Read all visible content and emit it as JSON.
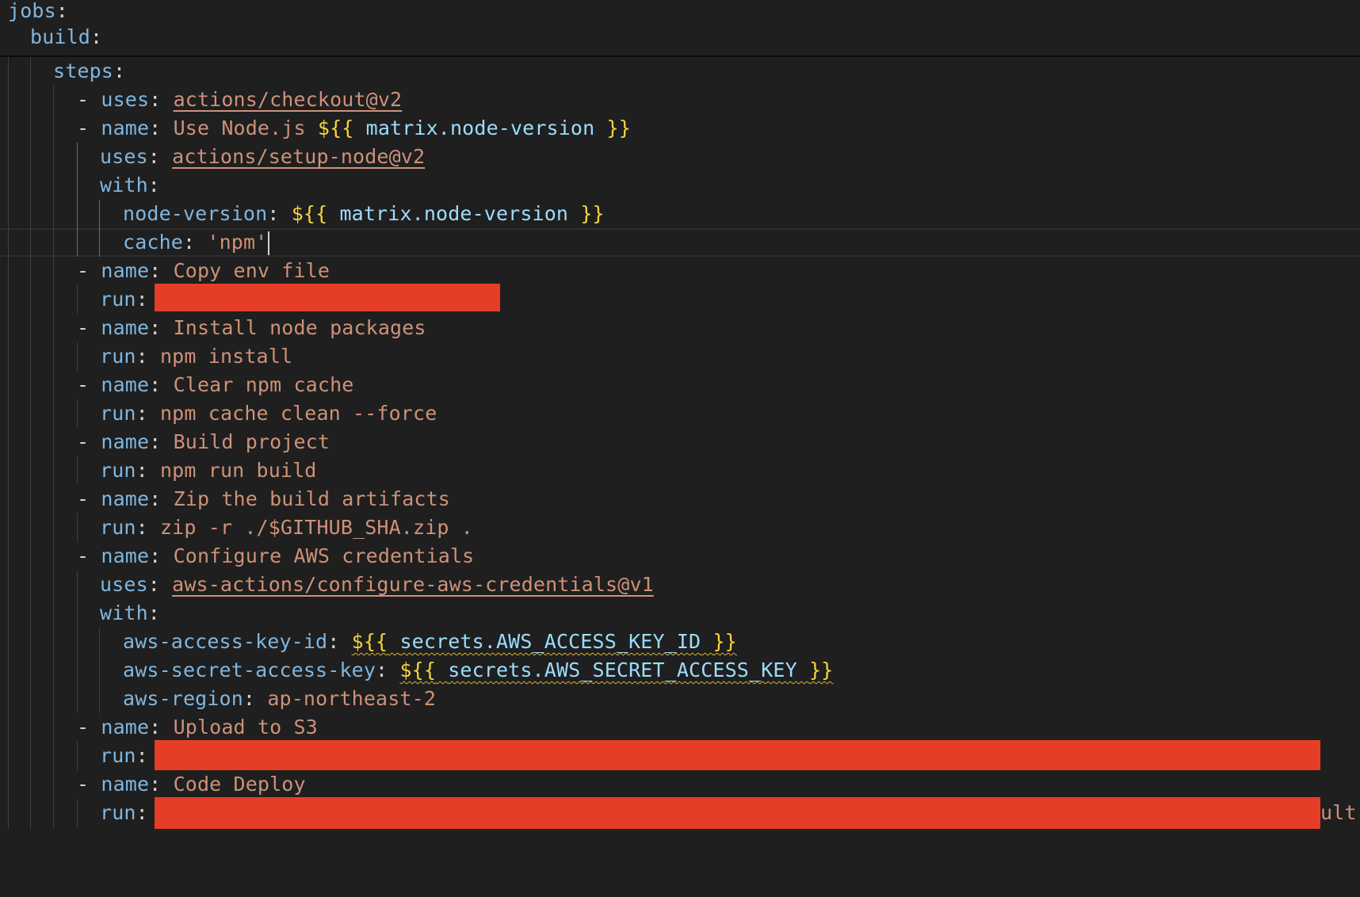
{
  "editor": {
    "language": "yaml",
    "sticky": {
      "jobs": "jobs",
      "build": "build"
    },
    "punct": {
      "colon": ":",
      "dash": "-"
    },
    "steps_key": "steps",
    "step_checkout": {
      "uses_key": "uses",
      "uses_value": "actions/checkout@v2"
    },
    "step_node": {
      "name_key": "name",
      "name_text": "Use Node.js ",
      "expr_open": "${{",
      "expr_var": "matrix.node-version",
      "expr_close": "}}",
      "uses_key": "uses",
      "uses_value": "actions/setup-node@v2",
      "with_key": "with",
      "node_version_key": "node-version",
      "cache_key": "cache",
      "cache_value": "'npm'"
    },
    "step_env": {
      "name_key": "name",
      "name_value": "Copy env file",
      "run_key": "run",
      "run_redacted": true
    },
    "step_install": {
      "name_key": "name",
      "name_value": "Install node packages",
      "run_key": "run",
      "run_value": "npm install"
    },
    "step_clear": {
      "name_key": "name",
      "name_value": "Clear npm cache",
      "run_key": "run",
      "run_value": "npm cache clean --force"
    },
    "step_build": {
      "name_key": "name",
      "name_value": "Build project",
      "run_key": "run",
      "run_value": "npm run build"
    },
    "step_zip": {
      "name_key": "name",
      "name_value": "Zip the build artifacts",
      "run_key": "run",
      "run_value": "zip -r ./$GITHUB_SHA.zip ."
    },
    "step_aws": {
      "name_key": "name",
      "name_value": "Configure AWS credentials",
      "uses_key": "uses",
      "uses_value": "aws-actions/configure-aws-credentials@v1",
      "with_key": "with",
      "access_key_key": "aws-access-key-id",
      "access_key_var": "secrets.AWS_ACCESS_KEY_ID",
      "secret_key_key": "aws-secret-access-key",
      "secret_key_var": "secrets.AWS_SECRET_ACCESS_KEY",
      "region_key": "aws-region",
      "region_value": "ap-northeast-2"
    },
    "step_s3": {
      "name_key": "name",
      "name_value": "Upload to S3",
      "run_key": "run",
      "run_redacted": true
    },
    "step_deploy": {
      "name_key": "name",
      "name_value": "Code Deploy",
      "run_key": "run",
      "run_redacted": true,
      "run_visible_tail": "ult."
    }
  },
  "colors": {
    "background": "#1f1f1f",
    "key": "#7fb6e0",
    "string": "#ce9178",
    "expression_bracket": "#f4d33d",
    "variable": "#9cdcfe",
    "redaction": "#e63e26",
    "warning_squiggle": "#d7b530"
  }
}
